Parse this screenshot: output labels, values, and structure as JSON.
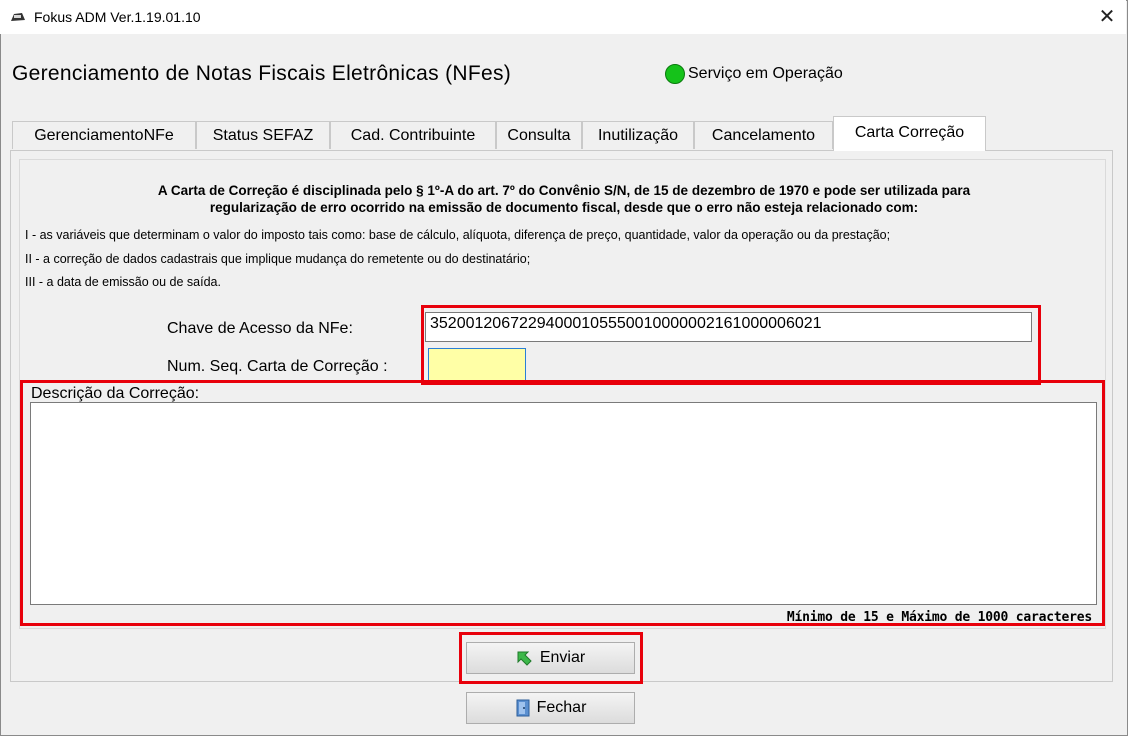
{
  "window": {
    "title": "Fokus ADM Ver.1.19.01.10",
    "close_glyph": "✕"
  },
  "header": {
    "title": "Gerenciamento de Notas Fiscais Eletrônicas (NFes)",
    "status_text": "Serviço em Operação",
    "status_color": "#15c21a"
  },
  "tabs": [
    {
      "label": "GerenciamentoNFe",
      "active": false
    },
    {
      "label": "Status SEFAZ",
      "active": false
    },
    {
      "label": "Cad. Contribuinte",
      "active": false
    },
    {
      "label": "Consulta",
      "active": false
    },
    {
      "label": "Inutilização",
      "active": false
    },
    {
      "label": "Cancelamento",
      "active": false
    },
    {
      "label": "Carta Correção",
      "active": true
    }
  ],
  "info": {
    "line1": "A Carta de Correção é disciplinada pelo § 1º-A do art. 7º do Convênio S/N, de 15 de dezembro de 1970 e pode ser utilizada para",
    "line2": "regularização de erro ocorrido na emissão de documento fiscal, desde que o erro não esteja relacionado com:",
    "rules": [
      "I - as variáveis que determinam o valor do imposto tais como: base de cálculo,  alíquota, diferença de preço, quantidade, valor da operação ou da prestação;",
      "II - a correção de dados cadastrais que implique mudança do remetente ou do destinatário;",
      "III - a data de emissão ou de saída."
    ]
  },
  "form": {
    "chave_label": "Chave de Acesso da NFe:",
    "chave_value": "35200120672294000105550010000002161000006021",
    "seq_label": "Num. Seq. Carta de Correção :",
    "seq_value": "",
    "desc_label": "Descrição da Correção:",
    "desc_value": "",
    "hint": "Mínimo de 15 e Máximo de 1000 caracteres"
  },
  "buttons": {
    "enviar": "Enviar",
    "fechar": "Fechar"
  },
  "highlight_color": "#e8000b"
}
